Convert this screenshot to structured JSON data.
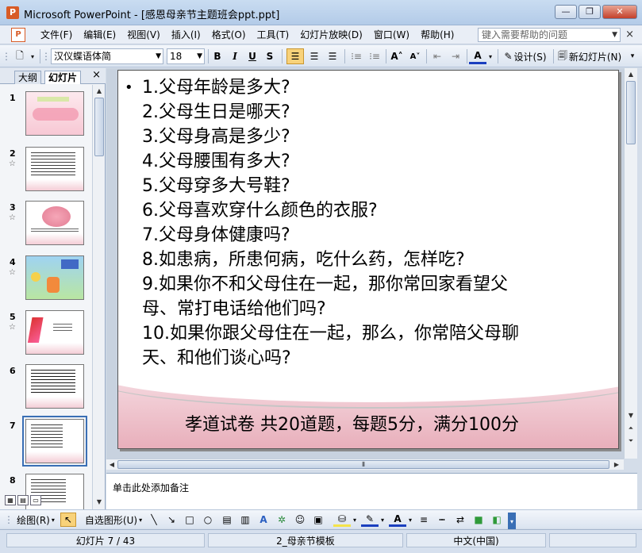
{
  "window": {
    "title": "Microsoft PowerPoint - [感恩母亲节主题班会ppt.ppt]",
    "buttons": {
      "minimize": "—",
      "restore": "❐",
      "close": "✕"
    }
  },
  "menu": {
    "items": [
      "文件(F)",
      "编辑(E)",
      "视图(V)",
      "插入(I)",
      "格式(O)",
      "工具(T)",
      "幻灯片放映(D)",
      "窗口(W)",
      "帮助(H)"
    ],
    "help_placeholder": "键入需要帮助的问题"
  },
  "toolbar": {
    "font_name": "汉仪蝶语体简",
    "font_size": "18",
    "bold": "B",
    "italic": "I",
    "underline": "U",
    "shadow": "S",
    "design_label": "设计(S)",
    "new_slide_label": "新幻灯片(N)"
  },
  "left_panel": {
    "tabs": [
      "大纲",
      "幻灯片"
    ],
    "close": "×",
    "slides": [
      {
        "number": "1",
        "star": ""
      },
      {
        "number": "2",
        "star": "☆"
      },
      {
        "number": "3",
        "star": "☆"
      },
      {
        "number": "4",
        "star": "☆"
      },
      {
        "number": "5",
        "star": "☆"
      },
      {
        "number": "6",
        "star": ""
      },
      {
        "number": "7",
        "star": ""
      },
      {
        "number": "8",
        "star": ""
      }
    ]
  },
  "slide": {
    "bullet": "•",
    "questions": [
      "1.父母年龄是多大?",
      "2.父母生日是哪天?",
      "3.父母身高是多少?",
      "4.父母腰围有多大?",
      "5.父母穿多大号鞋?",
      "6.父母喜欢穿什么颜色的衣服?",
      "7.父母身体健康吗?",
      "8.如患病，所患何病，吃什么药，怎样吃?",
      "9.如果你不和父母住在一起，那你常回家看望父",
      "母、常打电话给他们吗?",
      "10.如果你跟父母住在一起，那么，你常陪父母聊",
      "天、和他们谈心吗?"
    ],
    "footer": "孝道试卷 共20道题，每题5分，满分100分"
  },
  "notes_placeholder": "单击此处添加备注",
  "drawing_toolbar": {
    "draw_label": "绘图(R)",
    "autoshape_label": "自选图形(U)"
  },
  "status": {
    "slide_info": "幻灯片 7 / 43",
    "template": "2_母亲节模板",
    "language": "中文(中国)"
  }
}
